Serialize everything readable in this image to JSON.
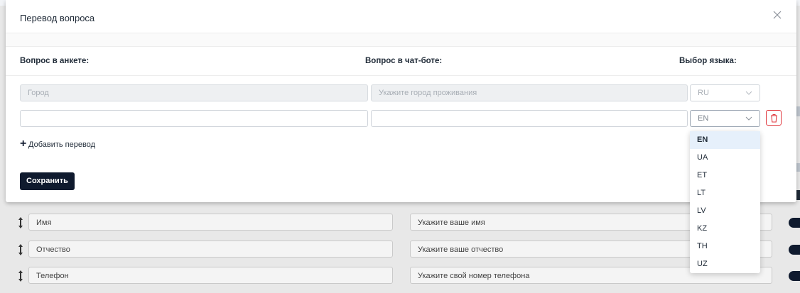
{
  "modal": {
    "title": "Перевод вопроса",
    "columns": {
      "questionnaire": "Вопрос в анкете:",
      "chatbot": "Вопрос в чат-боте:",
      "language": "Выбор языка:"
    },
    "rows": [
      {
        "questionnaire_value": "Город",
        "chatbot_value": "Укажите город проживания",
        "language": "RU",
        "disabled": true
      },
      {
        "questionnaire_value": "",
        "chatbot_value": "",
        "language": "EN",
        "disabled": false
      }
    ],
    "add_translation_label": "Добавить перевод",
    "save_label": "Сохранить"
  },
  "language_dropdown": {
    "selected": "EN",
    "options": [
      "EN",
      "UA",
      "ET",
      "LT",
      "LV",
      "KZ",
      "TH",
      "UZ"
    ]
  },
  "background_rows": [
    {
      "name": "Имя",
      "chatbot": "Укажите ваше имя"
    },
    {
      "name": "Отчество",
      "chatbot": "Укажите ваше отчество"
    },
    {
      "name": "Телефон",
      "chatbot": "Укажите свой номер телефона"
    }
  ],
  "colors": {
    "accent_dark": "#0f1a2e",
    "danger": "#e0373d",
    "dropdown_selected_bg": "#e6f0fb"
  }
}
